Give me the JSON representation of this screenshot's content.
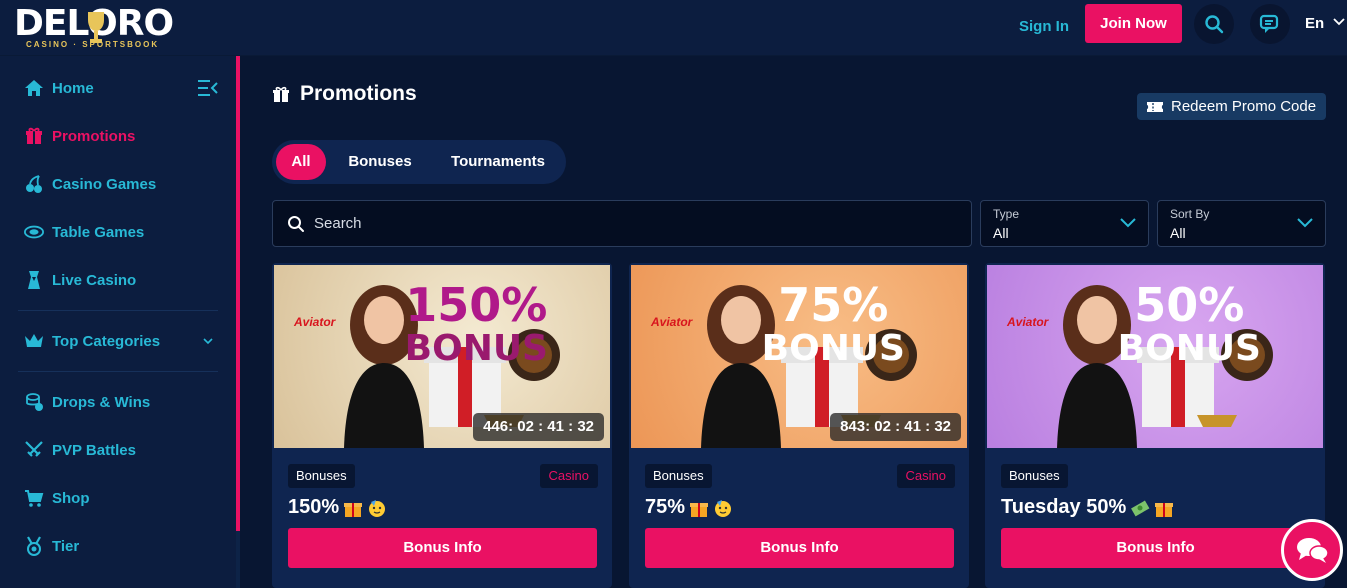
{
  "header": {
    "logo_text": "DELORO",
    "logo_subtext": "CASINO · SPORTSBOOK",
    "sign_in": "Sign In",
    "join_now": "Join Now",
    "language": "En"
  },
  "sidebar": {
    "items": [
      {
        "label": "Home",
        "icon": "home-icon"
      },
      {
        "label": "Promotions",
        "icon": "gift-icon",
        "active": true
      },
      {
        "label": "Casino Games",
        "icon": "cherries-icon"
      },
      {
        "label": "Table Games",
        "icon": "chip-icon"
      },
      {
        "label": "Live Casino",
        "icon": "dealer-icon"
      },
      {
        "label": "Top Categories",
        "icon": "crown-icon"
      },
      {
        "label": "Drops & Wins",
        "icon": "coins-icon"
      },
      {
        "label": "PVP Battles",
        "icon": "swords-icon"
      },
      {
        "label": "Shop",
        "icon": "cart-icon"
      },
      {
        "label": "Tier",
        "icon": "medal-icon"
      }
    ]
  },
  "main": {
    "title": "Promotions",
    "redeem_label": "Redeem Promo Code",
    "tabs": [
      "All",
      "Bonuses",
      "Tournaments"
    ],
    "active_tab": "All",
    "search_placeholder": "Search",
    "type_filter": {
      "label": "Type",
      "value": "All"
    },
    "sort_filter": {
      "label": "Sort By",
      "value": "All"
    }
  },
  "cards": [
    {
      "tag": "Bonuses",
      "category": "Casino",
      "title": "150%",
      "banner_pct": "150%",
      "banner_word": "BONUS",
      "timer": "446: 02 : 41 : 32",
      "button": "Bonus Info",
      "brand": "Aviator",
      "bg": "#e6d6b8"
    },
    {
      "tag": "Bonuses",
      "category": "Casino",
      "title": "75%",
      "banner_pct": "75%",
      "banner_word": "BONUS",
      "timer": "843: 02 : 41 : 32",
      "button": "Bonus Info",
      "brand": "Aviator",
      "bg": "#f2a66a"
    },
    {
      "tag": "Bonuses",
      "category": "",
      "title": "Tuesday 50%",
      "banner_pct": "50%",
      "banner_word": "BONUS",
      "timer": "",
      "button": "Bonus Info",
      "brand": "Aviator",
      "bg": "#c58ee6"
    }
  ],
  "colors": {
    "accent": "#ea1163",
    "cyan": "#28b9d6",
    "bg": "#081632",
    "panel": "#0c1d3f"
  }
}
